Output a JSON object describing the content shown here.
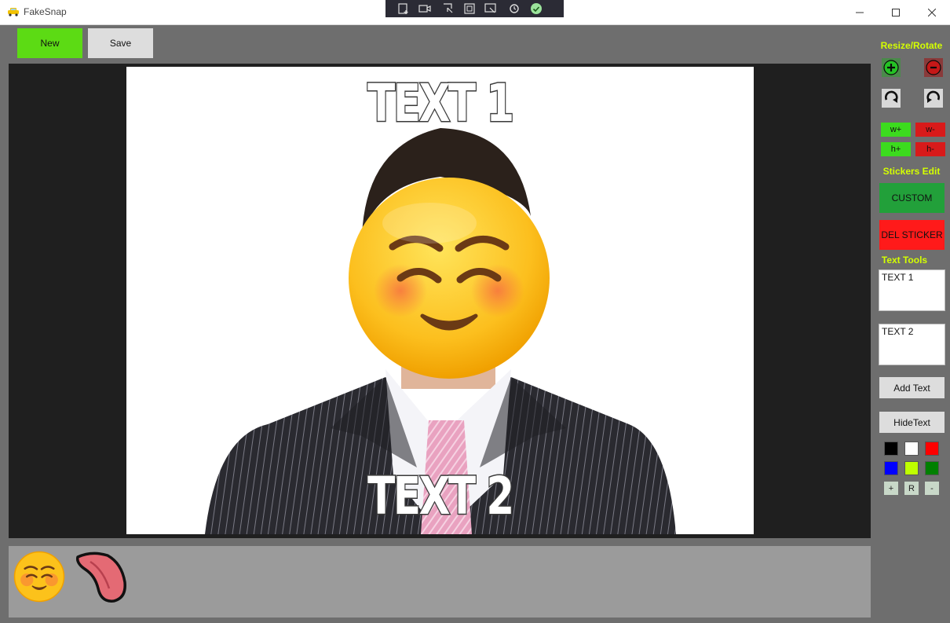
{
  "window": {
    "title": "FakeSnap",
    "icons": [
      "taxi-icon",
      "minimize-icon",
      "maximize-icon",
      "close-icon"
    ]
  },
  "capture_toolbar": {
    "icons": [
      "new-snip-icon",
      "video-icon",
      "freeform-icon",
      "rect-icon",
      "window-snip-icon",
      "delay-icon",
      "done-check-icon"
    ]
  },
  "toolbar": {
    "new_label": "New",
    "save_label": "Save"
  },
  "canvas": {
    "text_top": "TEXT 1",
    "text_bottom": "TEXT 2"
  },
  "sidebar": {
    "resize_heading": "Resize/Rotate",
    "w_plus": "w+",
    "w_minus": "w-",
    "h_plus": "h+",
    "h_minus": "h-",
    "stickers_heading": "Stickers Edit",
    "custom_label": "CUSTOM",
    "del_sticker_label": "DEL STICKER",
    "text_tools_heading": "Text Tools",
    "text1_value": "TEXT 1",
    "text2_value": "TEXT 2",
    "add_text_label": "Add Text",
    "hide_text_label": "HideText",
    "font_plus": "+",
    "font_reset": "R",
    "font_minus": "-"
  },
  "colors": {
    "black": "#000000",
    "white": "#ffffff",
    "red": "#ff0000",
    "blue": "#0000ff",
    "lime": "#bfff00",
    "green": "#008000",
    "new_button": "#5cdb14",
    "custom_button": "#22a03a",
    "del_button": "#ff1a1a",
    "heading": "#d4ff00"
  },
  "sticker_tray": {
    "items": [
      "blush-smile-emoji",
      "tongue-sticker"
    ]
  }
}
